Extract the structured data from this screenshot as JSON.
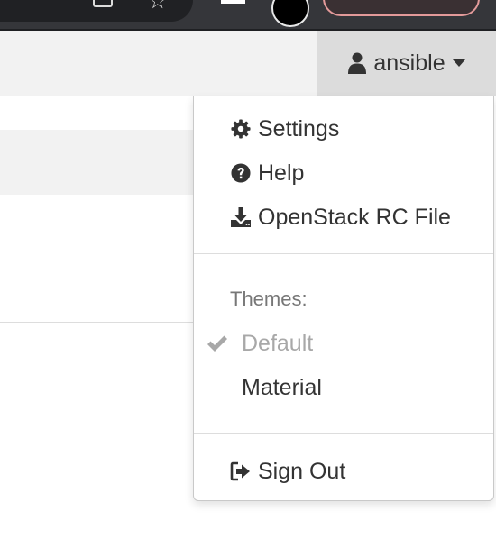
{
  "user_menu": {
    "username": "ansible",
    "items": [
      {
        "label": "Settings",
        "icon": "gear-icon"
      },
      {
        "label": "Help",
        "icon": "question-circle-icon"
      },
      {
        "label": "OpenStack RC File",
        "icon": "download-icon"
      }
    ],
    "themes_header": "Themes:",
    "themes": [
      {
        "label": "Default",
        "selected": true
      },
      {
        "label": "Material",
        "selected": false
      }
    ],
    "sign_out": {
      "label": "Sign Out",
      "icon": "sign-out-icon"
    }
  },
  "colors": {
    "navbar_bg": "#f2f2f2",
    "toggle_bg": "#dcdcdc",
    "selected_theme_text": "#a8a8a8",
    "text": "#333333"
  }
}
